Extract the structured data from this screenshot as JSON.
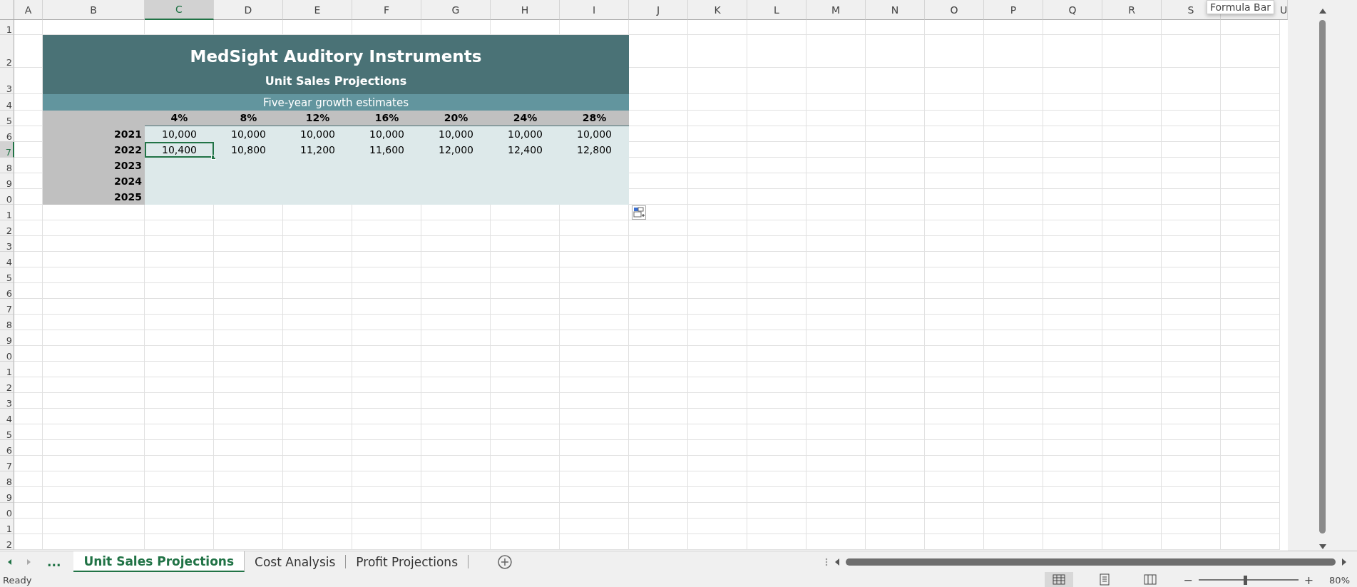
{
  "columns": [
    {
      "label": "A",
      "selected": false
    },
    {
      "label": "B",
      "selected": false
    },
    {
      "label": "C",
      "selected": true
    },
    {
      "label": "D",
      "selected": false
    },
    {
      "label": "E",
      "selected": false
    },
    {
      "label": "F",
      "selected": false
    },
    {
      "label": "G",
      "selected": false
    },
    {
      "label": "H",
      "selected": false
    },
    {
      "label": "I",
      "selected": false
    },
    {
      "label": "J",
      "selected": false
    },
    {
      "label": "K",
      "selected": false
    },
    {
      "label": "L",
      "selected": false
    },
    {
      "label": "M",
      "selected": false
    },
    {
      "label": "N",
      "selected": false
    },
    {
      "label": "O",
      "selected": false
    },
    {
      "label": "P",
      "selected": false
    },
    {
      "label": "Q",
      "selected": false
    },
    {
      "label": "R",
      "selected": false
    },
    {
      "label": "S",
      "selected": false
    },
    {
      "label": "U",
      "selected": false
    }
  ],
  "rows": [
    {
      "label": "1",
      "selected": false
    },
    {
      "label": "2",
      "selected": false
    },
    {
      "label": "3",
      "selected": false
    },
    {
      "label": "4",
      "selected": false
    },
    {
      "label": "5",
      "selected": false
    },
    {
      "label": "6",
      "selected": false
    },
    {
      "label": "7",
      "selected": true
    },
    {
      "label": "8",
      "selected": false
    },
    {
      "label": "9",
      "selected": false
    },
    {
      "label": "0",
      "selected": false
    },
    {
      "label": "1",
      "selected": false
    },
    {
      "label": "2",
      "selected": false
    },
    {
      "label": "3",
      "selected": false
    },
    {
      "label": "4",
      "selected": false
    },
    {
      "label": "5",
      "selected": false
    },
    {
      "label": "6",
      "selected": false
    },
    {
      "label": "7",
      "selected": false
    },
    {
      "label": "8",
      "selected": false
    },
    {
      "label": "9",
      "selected": false
    },
    {
      "label": "0",
      "selected": false
    },
    {
      "label": "1",
      "selected": false
    },
    {
      "label": "2",
      "selected": false
    },
    {
      "label": "3",
      "selected": false
    },
    {
      "label": "4",
      "selected": false
    },
    {
      "label": "5",
      "selected": false
    },
    {
      "label": "6",
      "selected": false
    },
    {
      "label": "7",
      "selected": false
    },
    {
      "label": "8",
      "selected": false
    },
    {
      "label": "9",
      "selected": false
    },
    {
      "label": "0",
      "selected": false
    },
    {
      "label": "1",
      "selected": false
    },
    {
      "label": "2",
      "selected": false
    }
  ],
  "sheet": {
    "title": "MedSight Auditory Instruments",
    "subtitle": "Unit Sales Projections",
    "caption": "Five-year growth estimates",
    "growth_rates": [
      "4%",
      "8%",
      "12%",
      "16%",
      "20%",
      "24%",
      "28%"
    ],
    "years": [
      {
        "year": "2021",
        "values": [
          {
            "text": "10,000",
            "selected": false
          },
          {
            "text": "10,000",
            "selected": false
          },
          {
            "text": "10,000",
            "selected": false
          },
          {
            "text": "10,000",
            "selected": false
          },
          {
            "text": "10,000",
            "selected": false
          },
          {
            "text": "10,000",
            "selected": false
          },
          {
            "text": "10,000",
            "selected": false
          }
        ]
      },
      {
        "year": "2022",
        "values": [
          {
            "text": "10,400",
            "selected": true
          },
          {
            "text": "10,800",
            "selected": false
          },
          {
            "text": "11,200",
            "selected": false
          },
          {
            "text": "11,600",
            "selected": false
          },
          {
            "text": "12,000",
            "selected": false
          },
          {
            "text": "12,400",
            "selected": false
          },
          {
            "text": "12,800",
            "selected": false
          }
        ]
      },
      {
        "year": "2023"
      },
      {
        "year": "2024"
      },
      {
        "year": "2025"
      }
    ]
  },
  "tooltip": "Formula Bar",
  "tabs_bar": {
    "more": "...",
    "tabs": [
      {
        "label": "Unit Sales Projections",
        "selected": true
      },
      {
        "label": "Cost Analysis",
        "selected": false
      },
      {
        "label": "Profit Projections",
        "selected": false
      }
    ]
  },
  "status_bar": {
    "status": "Ready",
    "views": [
      {
        "kind": "normal",
        "selected": true
      },
      {
        "kind": "page-layout",
        "selected": false
      },
      {
        "kind": "page-break",
        "selected": false
      }
    ],
    "zoom": {
      "out": "−",
      "level": 0.47,
      "in": "+",
      "reading": "80%"
    }
  }
}
